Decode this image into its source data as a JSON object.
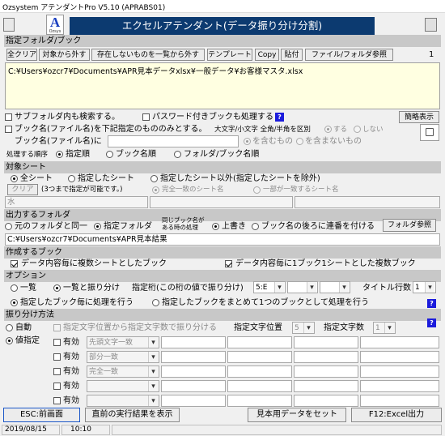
{
  "window": {
    "title": "Ozsystem アテンダントPro V5.10 (APRABS01)"
  },
  "header": {
    "banner": "エクセルアテンダント(データ振り分け分割)",
    "logo_letter": "A",
    "logo_sub": "Ozsys"
  },
  "folder_section": {
    "title": "指定フォルダ/ブック",
    "buttons": [
      "全クリア",
      "対象から外す",
      "存在しないものを一覧から外す",
      "テンプレート",
      "Copy",
      "貼付",
      "ファイル/フォルダ参照"
    ],
    "count": "1",
    "path": "C:¥Users¥ozcr7¥Documents¥APR見本データxlsx¥一般データ¥お客様マスタ.xlsx"
  },
  "options": {
    "subfolder": "サブフォルダ内も検索する。",
    "password": "パスワード付きブックも処理する",
    "help": "?",
    "simple_view": "簡略表示",
    "book_name_limit": "ブック名(ファイル名)を下記指定のもののみとする。",
    "case_label": "大文字/小文字 全角/半角を区別",
    "case_yes": "する",
    "case_no": "しない",
    "book_name_label": "ブック名(ファイル名)に",
    "contains": "を含むもの",
    "not_contains": "を含まないもの",
    "order_label": "処理する順序",
    "order_options": [
      "指定順",
      "ブック名順",
      "フォルダ/ブック名順"
    ]
  },
  "sheet_section": {
    "title": "対象シート",
    "options": [
      "全シート",
      "指定したシート",
      "指定したシート以外(指定したシートを除外)"
    ],
    "clear": "クリア",
    "note": "(3つまで指定が可能です。)",
    "match_full": "完全一致のシート名",
    "match_part": "一部が一致するシート名",
    "sheet_name_value": "水"
  },
  "output_section": {
    "title": "出力するフォルダ",
    "options": [
      "元のフォルダと同一",
      "指定フォルダ"
    ],
    "same_name_line1": "同じブック名が",
    "same_name_line2": "ある時の処理",
    "overwrite_options": [
      "上書き",
      "ブック名の後ろに連番を付ける"
    ],
    "folder_ref": "フォルダ参照",
    "path": "C:¥Users¥ozcr7¥Documents¥APR見本結果"
  },
  "create_section": {
    "title": "作成するブック",
    "multi_sheet": "データ内容毎に複数シートとしたブック",
    "one_sheet": "データ内容毎に1ブック1シートとした複数ブック"
  },
  "option_section": {
    "title": "オプション",
    "list_options": [
      "一覧",
      "一覧と振り分け"
    ],
    "digit_label": "指定桁(この桁の値で振り分け)",
    "digit_value": "5:E",
    "title_rows_label": "タイトル行数",
    "title_rows_value": "1",
    "process_options": [
      "指定したブック毎に処理を行う",
      "指定したブックをまとめて1つのブックとして処理を行う"
    ]
  },
  "method_section": {
    "title": "振り分け方法",
    "auto": "自動",
    "value_spec": "値指定",
    "range_label": "指定文字位置から指定文字数で振り分ける",
    "pos_label": "指定文字位置",
    "pos_value": "5",
    "count_label": "指定文字数",
    "count_value": "1",
    "rows": [
      {
        "enabled": "有効",
        "mode": "先頭文字一致"
      },
      {
        "enabled": "有効",
        "mode": "部分一致"
      },
      {
        "enabled": "有効",
        "mode": "完全一致"
      },
      {
        "enabled": "有効",
        "mode": ""
      },
      {
        "enabled": "有効",
        "mode": ""
      }
    ]
  },
  "bottom_buttons": {
    "esc": "ESC:前画面",
    "last_result": "直前の実行結果を表示",
    "set_sample": "見本用データをセット",
    "f12": "F12:Excel出力"
  },
  "status": {
    "date": "2019/08/15",
    "time": "10:10"
  },
  "colors": {
    "banner_bg": "#0c3a70",
    "section_bg": "#c8c8c8",
    "path_bg": "#ffffe1",
    "help_bg": "#1c1cdc"
  }
}
